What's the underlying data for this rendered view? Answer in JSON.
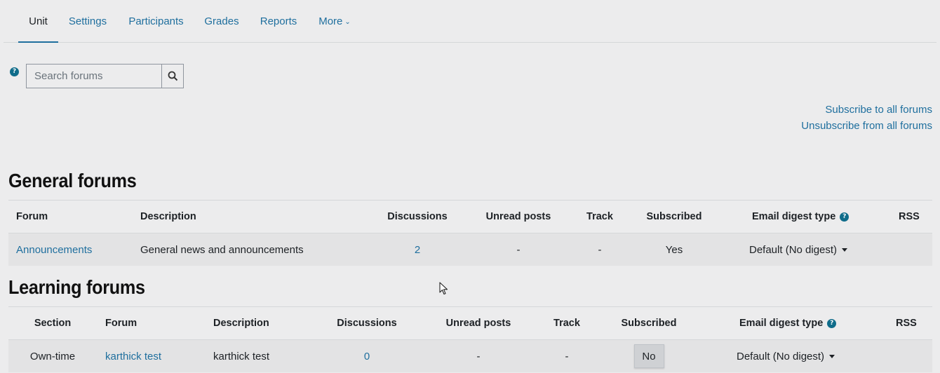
{
  "nav": {
    "tabs": [
      "Unit",
      "Settings",
      "Participants",
      "Grades",
      "Reports",
      "More"
    ],
    "active": "Unit"
  },
  "search": {
    "placeholder": "Search forums"
  },
  "subscription": {
    "subscribe_all": "Subscribe to all forums",
    "unsubscribe_all": "Unsubscribe from all forums"
  },
  "general": {
    "heading": "General forums",
    "columns": {
      "forum": "Forum",
      "description": "Description",
      "discussions": "Discussions",
      "unread": "Unread posts",
      "track": "Track",
      "subscribed": "Subscribed",
      "digest": "Email digest type",
      "rss": "RSS"
    },
    "rows": [
      {
        "forum": "Announcements",
        "description": "General news and announcements",
        "discussions": "2",
        "unread": "-",
        "track": "-",
        "subscribed": "Yes",
        "digest": "Default (No digest)"
      }
    ]
  },
  "learning": {
    "heading": "Learning forums",
    "columns": {
      "section": "Section",
      "forum": "Forum",
      "description": "Description",
      "discussions": "Discussions",
      "unread": "Unread posts",
      "track": "Track",
      "subscribed": "Subscribed",
      "digest": "Email digest type",
      "rss": "RSS"
    },
    "rows": [
      {
        "section": "Own-time",
        "forum": "karthick test",
        "description": "karthick test",
        "discussions": "0",
        "unread": "-",
        "track": "-",
        "subscribed": "No",
        "digest": "Default (No digest)"
      }
    ]
  },
  "icons": {
    "help": "question-circle-icon",
    "search": "search-icon",
    "chevron": "chevron-down-icon",
    "caret": "caret-down-icon",
    "cursor": "mouse-cursor-icon"
  },
  "colors": {
    "link": "#1f6f9e",
    "help_icon": "#0f6c8a",
    "background": "#ececed"
  }
}
